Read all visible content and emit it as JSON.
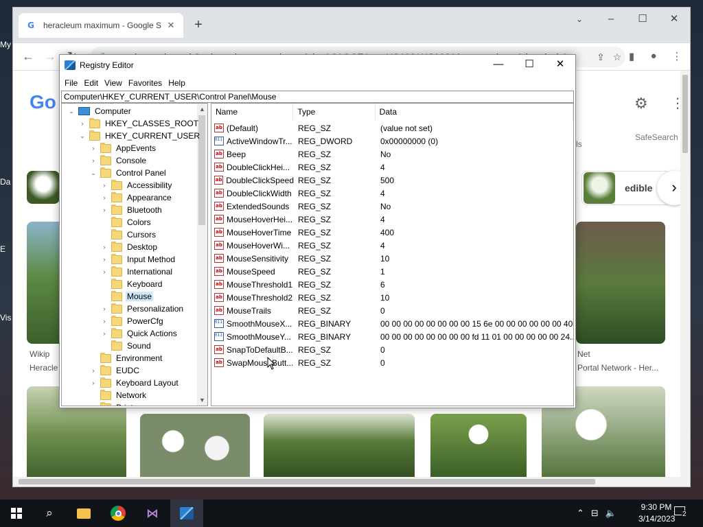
{
  "desktop": {
    "labels": [
      "My",
      "Da",
      "E",
      "Vis"
    ]
  },
  "chrome": {
    "tab_title": "heracleum maximum - Google S",
    "url": "google.com/search?q=heracleum+maximum&rlz=1C1GCEA_enUS1021US1021&source=lnms&tbm=isch&...",
    "safesearch": "SafeSearch",
    "tools_tail": "ls",
    "chip_label": "edible",
    "captions": [
      "Wikip",
      "Heracle",
      "Net",
      "Portal Network - Her..."
    ]
  },
  "regedit": {
    "title": "Registry Editor",
    "menu": [
      "File",
      "Edit",
      "View",
      "Favorites",
      "Help"
    ],
    "address": "Computer\\HKEY_CURRENT_USER\\Control Panel\\Mouse",
    "tree": [
      {
        "label": "Computer",
        "level": 0,
        "twisty": "expanded",
        "icon": "pc"
      },
      {
        "label": "HKEY_CLASSES_ROOT",
        "level": 1,
        "twisty": "collapsed",
        "icon": "folder"
      },
      {
        "label": "HKEY_CURRENT_USER",
        "level": 1,
        "twisty": "expanded",
        "icon": "folder"
      },
      {
        "label": "AppEvents",
        "level": 2,
        "twisty": "collapsed",
        "icon": "folder"
      },
      {
        "label": "Console",
        "level": 2,
        "twisty": "collapsed",
        "icon": "folder"
      },
      {
        "label": "Control Panel",
        "level": 2,
        "twisty": "expanded",
        "icon": "folder"
      },
      {
        "label": "Accessibility",
        "level": 3,
        "twisty": "collapsed",
        "icon": "folder"
      },
      {
        "label": "Appearance",
        "level": 3,
        "twisty": "collapsed",
        "icon": "folder"
      },
      {
        "label": "Bluetooth",
        "level": 3,
        "twisty": "collapsed",
        "icon": "folder"
      },
      {
        "label": "Colors",
        "level": 3,
        "twisty": "none",
        "icon": "folder"
      },
      {
        "label": "Cursors",
        "level": 3,
        "twisty": "none",
        "icon": "folder"
      },
      {
        "label": "Desktop",
        "level": 3,
        "twisty": "collapsed",
        "icon": "folder"
      },
      {
        "label": "Input Method",
        "level": 3,
        "twisty": "collapsed",
        "icon": "folder"
      },
      {
        "label": "International",
        "level": 3,
        "twisty": "collapsed",
        "icon": "folder"
      },
      {
        "label": "Keyboard",
        "level": 3,
        "twisty": "none",
        "icon": "folder"
      },
      {
        "label": "Mouse",
        "level": 3,
        "twisty": "none",
        "icon": "folder",
        "selected": true
      },
      {
        "label": "Personalization",
        "level": 3,
        "twisty": "collapsed",
        "icon": "folder"
      },
      {
        "label": "PowerCfg",
        "level": 3,
        "twisty": "collapsed",
        "icon": "folder"
      },
      {
        "label": "Quick Actions",
        "level": 3,
        "twisty": "collapsed",
        "icon": "folder"
      },
      {
        "label": "Sound",
        "level": 3,
        "twisty": "none",
        "icon": "folder"
      },
      {
        "label": "Environment",
        "level": 2,
        "twisty": "none",
        "icon": "folder"
      },
      {
        "label": "EUDC",
        "level": 2,
        "twisty": "collapsed",
        "icon": "folder"
      },
      {
        "label": "Keyboard Layout",
        "level": 2,
        "twisty": "collapsed",
        "icon": "folder"
      },
      {
        "label": "Network",
        "level": 2,
        "twisty": "none",
        "icon": "folder"
      },
      {
        "label": "Printers",
        "level": 2,
        "twisty": "collapsed",
        "icon": "folder"
      }
    ],
    "columns": [
      "Name",
      "Type",
      "Data"
    ],
    "values": [
      {
        "name": "(Default)",
        "type": "REG_SZ",
        "data": "(value not set)",
        "icon": "string-value-icon"
      },
      {
        "name": "ActiveWindowTr...",
        "type": "REG_DWORD",
        "data": "0x00000000 (0)",
        "icon": "binary-value-icon"
      },
      {
        "name": "Beep",
        "type": "REG_SZ",
        "data": "No",
        "icon": "string-value-icon"
      },
      {
        "name": "DoubleClickHei...",
        "type": "REG_SZ",
        "data": "4",
        "icon": "string-value-icon"
      },
      {
        "name": "DoubleClickSpeed",
        "type": "REG_SZ",
        "data": "500",
        "icon": "string-value-icon"
      },
      {
        "name": "DoubleClickWidth",
        "type": "REG_SZ",
        "data": "4",
        "icon": "string-value-icon"
      },
      {
        "name": "ExtendedSounds",
        "type": "REG_SZ",
        "data": "No",
        "icon": "string-value-icon"
      },
      {
        "name": "MouseHoverHei...",
        "type": "REG_SZ",
        "data": "4",
        "icon": "string-value-icon"
      },
      {
        "name": "MouseHoverTime",
        "type": "REG_SZ",
        "data": "400",
        "icon": "string-value-icon"
      },
      {
        "name": "MouseHoverWi...",
        "type": "REG_SZ",
        "data": "4",
        "icon": "string-value-icon"
      },
      {
        "name": "MouseSensitivity",
        "type": "REG_SZ",
        "data": "10",
        "icon": "string-value-icon"
      },
      {
        "name": "MouseSpeed",
        "type": "REG_SZ",
        "data": "1",
        "icon": "string-value-icon"
      },
      {
        "name": "MouseThreshold1",
        "type": "REG_SZ",
        "data": "6",
        "icon": "string-value-icon"
      },
      {
        "name": "MouseThreshold2",
        "type": "REG_SZ",
        "data": "10",
        "icon": "string-value-icon"
      },
      {
        "name": "MouseTrails",
        "type": "REG_SZ",
        "data": "0",
        "icon": "string-value-icon"
      },
      {
        "name": "SmoothMouseX...",
        "type": "REG_BINARY",
        "data": "00 00 00 00 00 00 00 00 15 6e 00 00 00 00 00 00 40...",
        "icon": "binary-value-icon"
      },
      {
        "name": "SmoothMouseY...",
        "type": "REG_BINARY",
        "data": "00 00 00 00 00 00 00 00 fd 11 01 00 00 00 00 00 24...",
        "icon": "binary-value-icon"
      },
      {
        "name": "SnapToDefaultB...",
        "type": "REG_SZ",
        "data": "0",
        "icon": "string-value-icon"
      },
      {
        "name": "SwapMouseButt...",
        "type": "REG_SZ",
        "data": "0",
        "icon": "string-value-icon"
      }
    ]
  },
  "taskbar": {
    "time": "9:30 PM",
    "date": "3/14/2023",
    "notification_count": "2"
  }
}
